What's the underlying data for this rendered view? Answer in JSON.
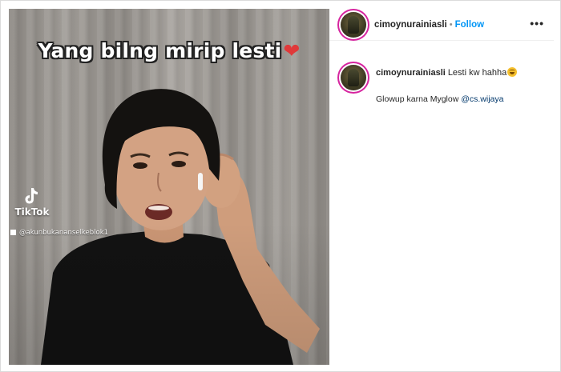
{
  "video": {
    "overlay_caption": "Yang bilng mirip lesti",
    "heart_emoji": "❤",
    "watermark_brand": "TikTok",
    "watermark_handle": "@akunbukananselkeblok1"
  },
  "post_header": {
    "username": "cimoynurainiasli",
    "separator": "•",
    "follow_label": "Follow",
    "more_label": "•••"
  },
  "caption": {
    "username": "cimoynurainiasli",
    "text": "Lesti kw hahha",
    "emoji_icon": "rolling-on-floor-laughing-emoji",
    "line2_text": "Glowup karna Myglow",
    "mention": "@cs.wijaya"
  },
  "colors": {
    "link_blue": "#0095f6",
    "mention_blue": "#00376b",
    "story_ring": "#d6249f"
  }
}
